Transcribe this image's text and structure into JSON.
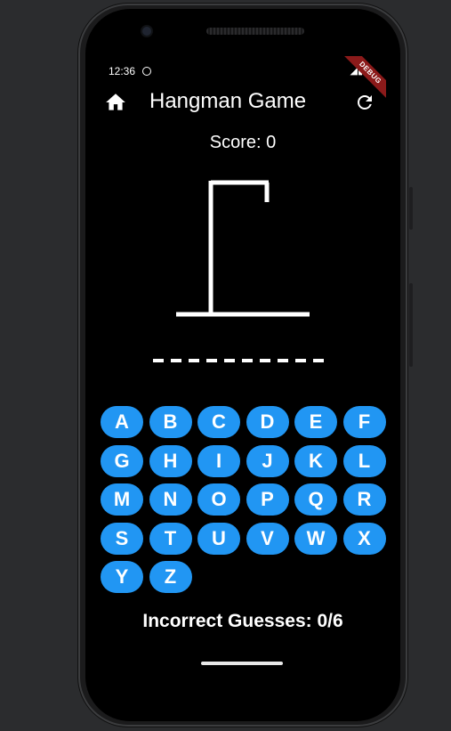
{
  "status_bar": {
    "time": "12:36",
    "debug_label": "DEBUG"
  },
  "app_bar": {
    "title": "Hangman Game",
    "home_icon": "home-icon",
    "refresh_icon": "refresh-icon"
  },
  "game": {
    "score_text": "Score: 0",
    "blank_count": 10,
    "incorrect_text": "Incorrect Guesses: 0/6"
  },
  "keyboard": {
    "keys": [
      "A",
      "B",
      "C",
      "D",
      "E",
      "F",
      "G",
      "H",
      "I",
      "J",
      "K",
      "L",
      "M",
      "N",
      "O",
      "P",
      "Q",
      "R",
      "S",
      "T",
      "U",
      "V",
      "W",
      "X",
      "Y",
      "Z"
    ]
  },
  "colors": {
    "key_background": "#2196f3",
    "screen_background": "#000000",
    "text": "#ffffff"
  }
}
